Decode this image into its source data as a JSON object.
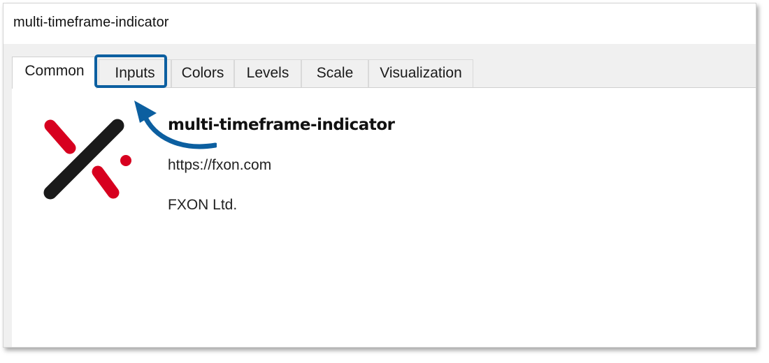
{
  "window": {
    "title": "multi-timeframe-indicator"
  },
  "tabs": [
    {
      "label": "Common",
      "active": true
    },
    {
      "label": "Inputs",
      "active": false,
      "highlighted": true
    },
    {
      "label": "Colors",
      "active": false
    },
    {
      "label": "Levels",
      "active": false
    },
    {
      "label": "Scale",
      "active": false
    },
    {
      "label": "Visualization",
      "active": false
    }
  ],
  "info": {
    "name": "multi-timeframe-indicator",
    "link": "https://fxon.com",
    "company": "FXON Ltd."
  },
  "logo": {
    "icon": "fxon-x-logo",
    "colors": {
      "red": "#d7001f",
      "black": "#1a1a1a"
    }
  },
  "annotation": {
    "color": "#0c5fa0",
    "icon": "curved-arrow-icon"
  }
}
